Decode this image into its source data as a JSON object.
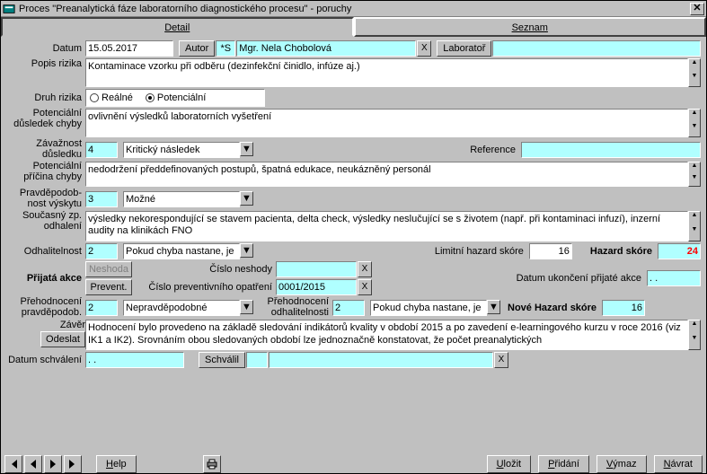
{
  "window": {
    "title": "Proces \"Preanalytická fáze laboratorního diagnostického procesu\" - poruchy"
  },
  "tabs": {
    "detail": "Detail",
    "seznam": "Seznam"
  },
  "labels": {
    "datum": "Datum",
    "autor": "Autor",
    "autor_code": "*S",
    "laborator": "Laboratoř",
    "popis_rizika": "Popis rizika",
    "druh_rizika": "Druh rizika",
    "realne": "Reálné",
    "potencialni": "Potenciální",
    "pot_dusledek1": "Potenciální",
    "pot_dusledek2": "důsledek chyby",
    "zavaznost1": "Závažnost",
    "zavaznost2": "důsledku",
    "reference": "Reference",
    "pot_pricina1": "Potenciální",
    "pot_pricina2": "příčina chyby",
    "pravdepodob1": "Pravděpodob-",
    "pravdepodob2": "nost výskytu",
    "soucasny1": "Současný zp.",
    "soucasny2": "odhalení",
    "odhalitelnost": "Odhalitelnost",
    "limit_hazard": "Limitní hazard skóre",
    "hazard_skore": "Hazard skóre",
    "prijata_akce": "Přijatá akce",
    "neshoda": "Neshoda",
    "cislo_neshody": "Číslo neshody",
    "prevent": "Prevent.",
    "cislo_prev_opatr": "Číslo preventivního opatření",
    "datum_ukonceni": "Datum ukončení přijaté akce",
    "prehod1": "Přehodnocení",
    "prehod2": "pravděpodob.",
    "prehod_odh1": "Přehodnocení",
    "prehod_odh2": "odhalitelnosti",
    "nove_hazard": "Nové Hazard skóre",
    "zaver": "Závěr",
    "odeslat": "Odeslat",
    "datum_schvaleni": "Datum schválení",
    "schvalil": "Schválil"
  },
  "values": {
    "datum": "15.05.2017",
    "autor": "Mgr. Nela Chobolová",
    "laborator": "",
    "popis_rizika": "Kontaminace vzorku při odběru (dezinfekční činidlo, infúze aj.)",
    "druh_rizika": "Potenciální",
    "pot_dusledek": "ovlivnění výsledků laboratorních vyšetření",
    "zavaznost_num": "4",
    "zavaznost_txt": "Kritický následek",
    "reference": "",
    "pot_pricina": "nedodržení předdefinovaných postupů, špatná edukace, neukázněný personál",
    "pravdepodob_num": "3",
    "pravdepodob_txt": "Možné",
    "soucasny": "výsledky nekorespondující se stavem pacienta, delta check, výsledky neslučující se s životem (např. při kontaminaci infuzí), inzerní audity na klinikách FNO",
    "odhalitelnost_num": "2",
    "odhalitelnost_txt": "Pokud chyba nastane, je",
    "limit_hazard": "16",
    "hazard_skore": "24",
    "cislo_neshody": "",
    "cislo_prev": "0001/2015",
    "datum_ukonceni": ".  .",
    "prehod_num": "2",
    "prehod_txt": "Nepravděpodobné",
    "prehod_odh_num": "2",
    "prehod_odh_txt": "Pokud chyba nastane, je",
    "nove_hazard": "16",
    "zaver_txt": "Hodnocení bylo provedeno na základě sledování indikátorů kvality v období 2015 a po zavedení e-learningového kurzu v roce 2016 (viz IK1 a IK2). Srovnáním obou sledovaných období lze jednoznačně konstatovat, že počet preanalytických",
    "datum_schvaleni": ".  .",
    "schvalil": ""
  },
  "buttons": {
    "help": "Help",
    "ulozit": "Uložit",
    "pridani": "Přidání",
    "vymaz": "Výmaz",
    "navrat": "Návrat"
  }
}
